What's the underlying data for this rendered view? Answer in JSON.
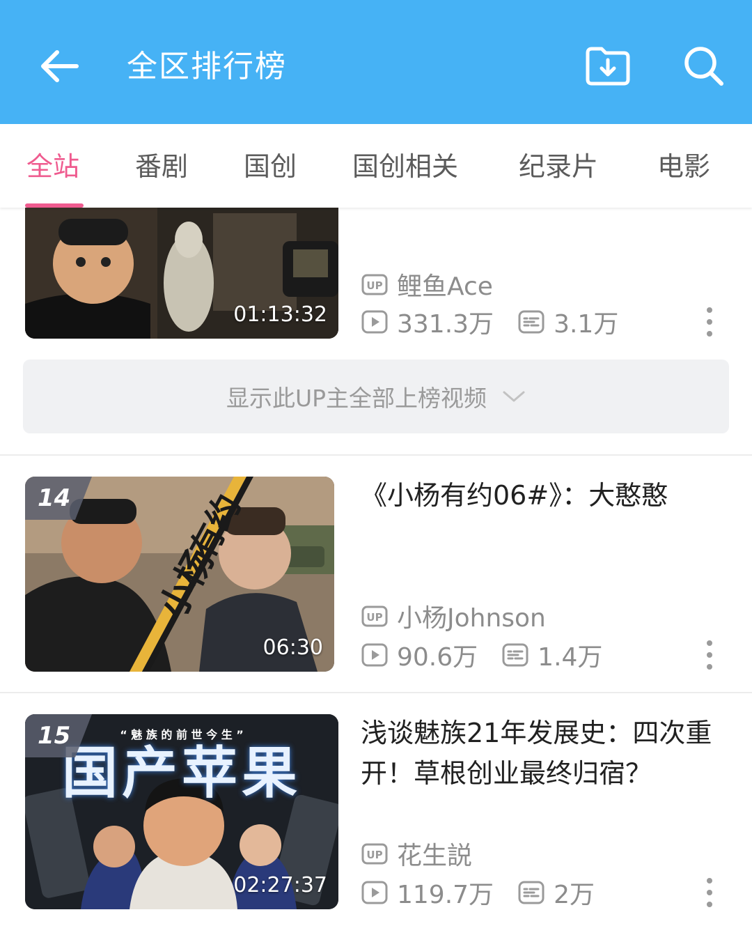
{
  "header": {
    "title": "全区排行榜",
    "background": "#46b2f5",
    "back_icon": "arrow-left-icon",
    "download_icon": "folder-download-icon",
    "search_icon": "search-icon"
  },
  "tabs": [
    {
      "label": "全站",
      "active": true
    },
    {
      "label": "番剧",
      "active": false
    },
    {
      "label": "国创",
      "active": false
    },
    {
      "label": "国创相关",
      "active": false
    },
    {
      "label": "纪录片",
      "active": false
    },
    {
      "label": "电影",
      "active": false
    }
  ],
  "accent_color": "#ef5b8f",
  "items": [
    {
      "rank": "",
      "title": "",
      "duration": "01:13:32",
      "uploader": "鲤鱼Ace",
      "views": "331.3万",
      "danmaku": "3.1万"
    },
    {
      "rank": "14",
      "title": "《小杨有约06#》：大憨憨",
      "duration": "06:30",
      "uploader": "小杨Johnson",
      "views": "90.6万",
      "danmaku": "1.4万"
    },
    {
      "rank": "15",
      "title": "浅谈魅族21年发展史：四次重开！草根创业最终归宿？",
      "duration": "02:27:37",
      "uploader": "花生説",
      "views": "119.7万",
      "danmaku": "2万"
    }
  ],
  "show_all_label": "显示此UP主全部上榜视频",
  "thumbnail_text": {
    "item2_left": "小杨",
    "item2_right": "有约",
    "item3_top": "“ 魅 族 的 前 世 今 生 ”",
    "item3_big": "国产苹果"
  },
  "icons": {
    "uploader": "up-badge-icon",
    "views": "play-count-icon",
    "danmaku": "danmaku-icon",
    "more": "more-vertical-icon",
    "expand": "chevron-down-icon"
  }
}
